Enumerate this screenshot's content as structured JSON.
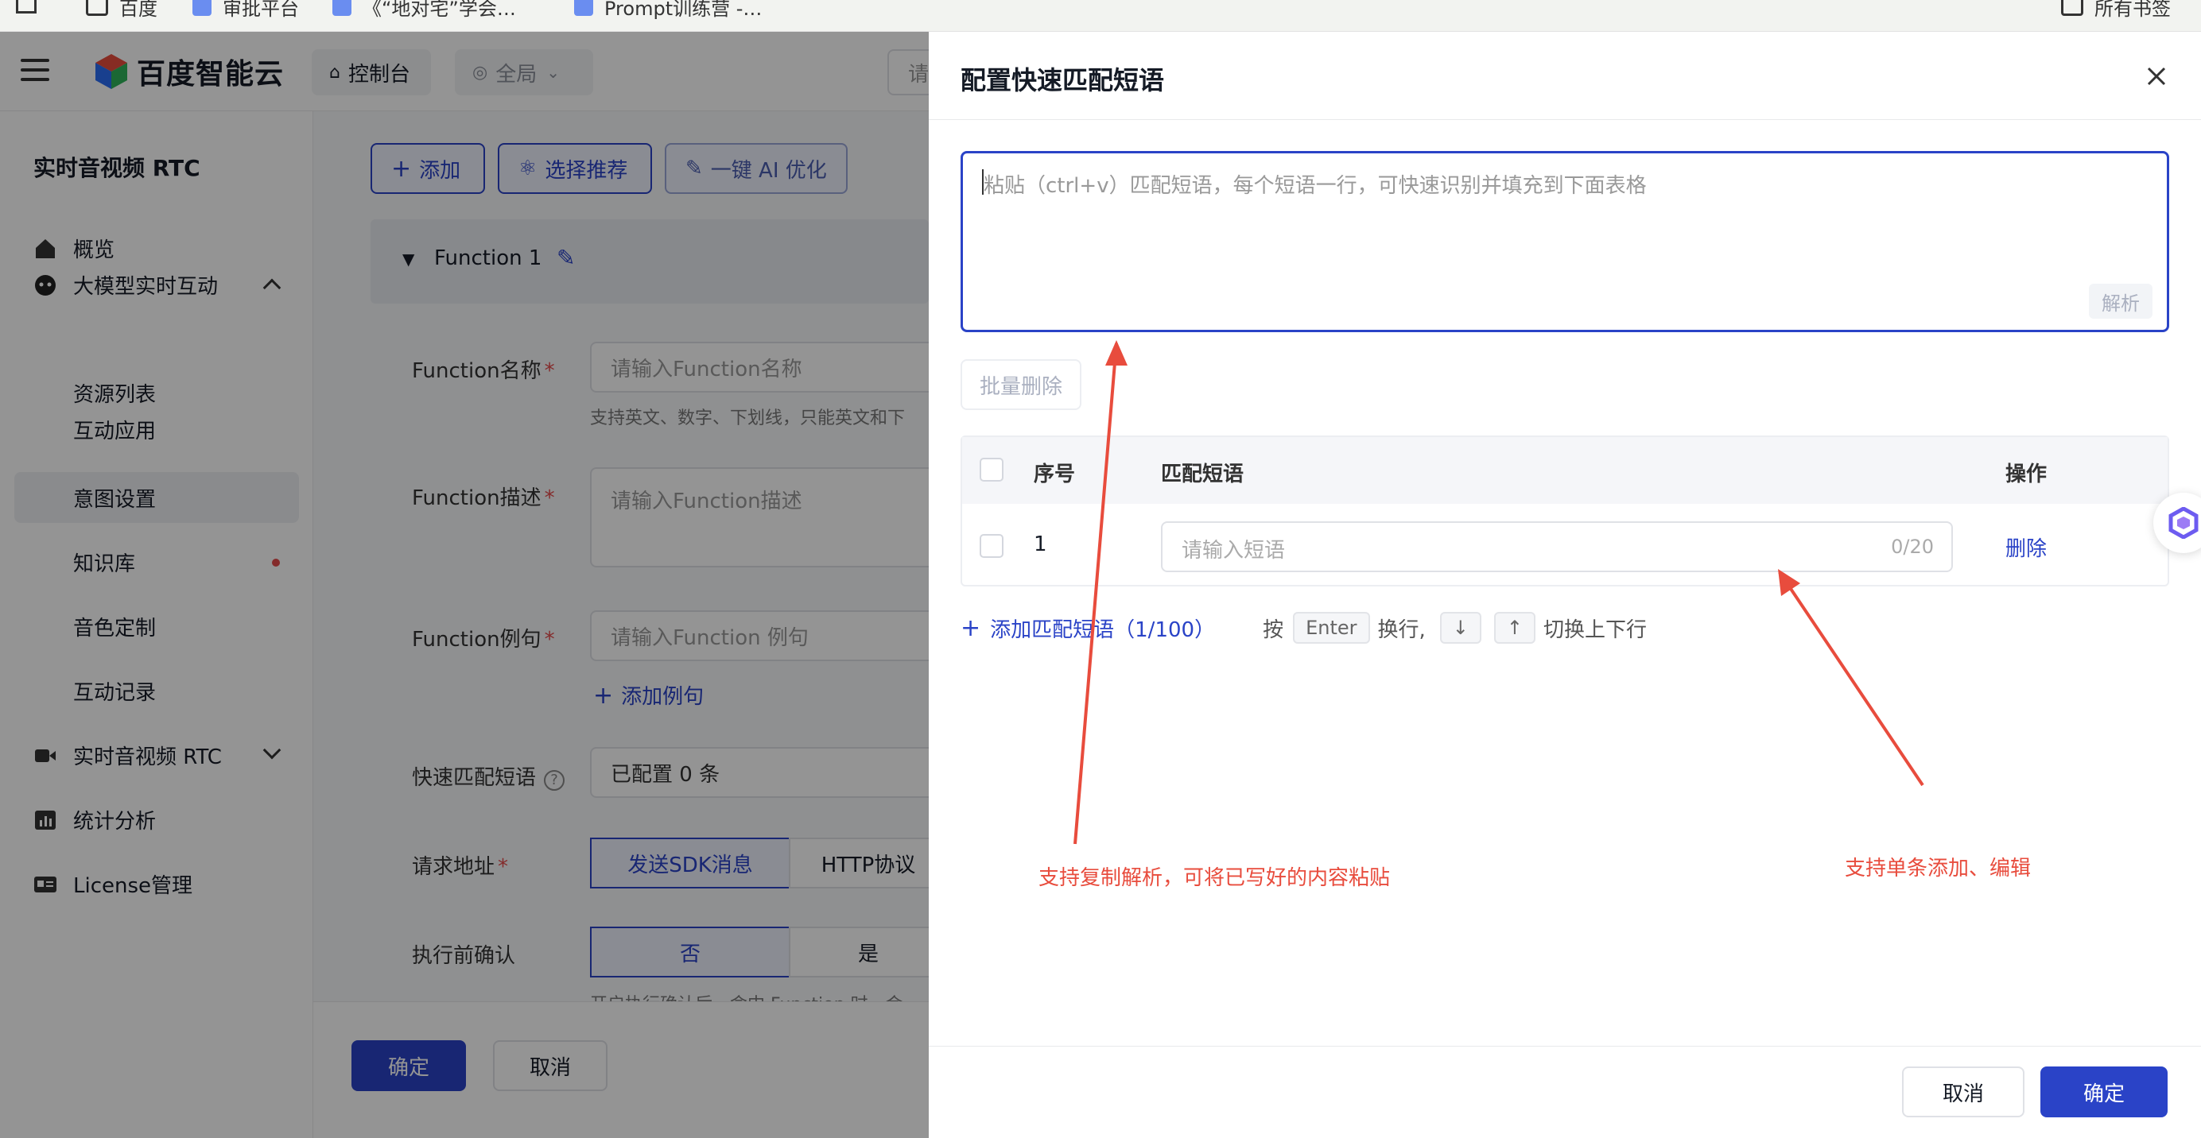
{
  "bookmarks": [
    "百度",
    "审批平台",
    "《“地对宅”学会…",
    "Prompt训练营 -…",
    "所有书签"
  ],
  "topbar": {
    "brand": "百度智能云",
    "console": "控制台",
    "region": "全局",
    "search_stub": "请"
  },
  "sidebar": {
    "title": "实时音视频 RTC",
    "items": [
      {
        "label": "概览"
      },
      {
        "label": "大模型实时互动"
      },
      {
        "label": "资源列表"
      },
      {
        "label": "互动应用"
      },
      {
        "label": "意图设置"
      },
      {
        "label": "知识库"
      },
      {
        "label": "音色定制"
      },
      {
        "label": "互动记录"
      },
      {
        "label": "实时音视频 RTC"
      },
      {
        "label": "统计分析"
      },
      {
        "label": "License管理"
      }
    ]
  },
  "main": {
    "toolbar": {
      "add": "添加",
      "recommend": "选择推荐",
      "ai_optimize": "一键 AI 优化"
    },
    "function_title": "Function 1",
    "fields": {
      "name_label": "Function名称",
      "name_placeholder": "请输入Function名称",
      "name_hint": "支持英文、数字、下划线，只能英文和下",
      "desc_label": "Function描述",
      "desc_placeholder": "请输入Function描述",
      "example_label": "Function例句",
      "example_placeholder": "请输入Function 例句",
      "add_example": "添加例句",
      "quick_label": "快速匹配短语",
      "quick_value": "已配置 0 条",
      "url_label": "请求地址",
      "url_opt1": "发送SDK消息",
      "url_opt2": "HTTP协议",
      "confirm_label": "执行前确认",
      "confirm_no": "否",
      "confirm_yes": "是",
      "confirm_hint": "开启执行确认后，命中 Function 时，会"
    },
    "footer": {
      "ok": "确定",
      "cancel": "取消"
    }
  },
  "drawer": {
    "title": "配置快速匹配短语",
    "textarea_placeholder": "粘贴（ctrl+v）匹配短语，每个短语一行，可快速识别并填充到下面表格",
    "parse_button": "解析",
    "batch_delete": "批量删除",
    "table": {
      "headers": [
        "序号",
        "匹配短语",
        "操作"
      ],
      "rows": [
        {
          "index": "1",
          "placeholder": "请输入短语",
          "counter": "0/20",
          "action": "删除"
        }
      ]
    },
    "add_phrase": "添加匹配短语（1/100）",
    "shortcut": {
      "press": "按",
      "enter_key": "Enter",
      "newline": "换行,",
      "switch": "切换上下行"
    },
    "annotations": {
      "left": "支持复制解析，可将已写好的内容粘贴",
      "right": "支持单条添加、编辑"
    },
    "footer": {
      "cancel": "取消",
      "ok": "确定"
    }
  },
  "colors": {
    "accent": "#2a43c7",
    "annotation": "#e84c3d"
  }
}
